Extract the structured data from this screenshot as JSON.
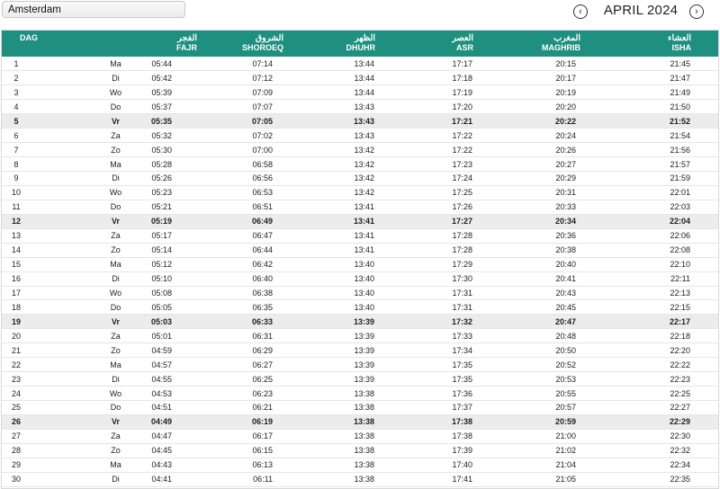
{
  "city_select": {
    "value": "Amsterdam"
  },
  "nav": {
    "prev_icon": "chevron-left-icon",
    "next_icon": "chevron-right-icon",
    "prev_glyph": "‹",
    "next_glyph": "›"
  },
  "month_title": "APRIL 2024",
  "header": {
    "dag": "DAG",
    "fajr_ar": "الفجر",
    "fajr": "FAJR",
    "shoroeq_ar": "الشروق",
    "shoroeq": "SHOROEQ",
    "dhuhr_ar": "الظهر",
    "dhuhr": "DHUHR",
    "asr_ar": "العصر",
    "asr": "ASR",
    "maghrib_ar": "المغرب",
    "maghrib": "MAGHRIB",
    "isha_ar": "العشاء",
    "isha": "ISHA"
  },
  "colors": {
    "header_bg": "#1f8f7f",
    "friday_bg": "#ececec"
  },
  "rows": [
    {
      "day": "1",
      "wd": "Ma",
      "fajr": "05:44",
      "shoroeq": "07:14",
      "dhuhr": "13:44",
      "asr": "17:17",
      "maghrib": "20:15",
      "isha": "21:45"
    },
    {
      "day": "2",
      "wd": "Di",
      "fajr": "05:42",
      "shoroeq": "07:12",
      "dhuhr": "13:44",
      "asr": "17:18",
      "maghrib": "20:17",
      "isha": "21:47"
    },
    {
      "day": "3",
      "wd": "Wo",
      "fajr": "05:39",
      "shoroeq": "07:09",
      "dhuhr": "13:44",
      "asr": "17:19",
      "maghrib": "20:19",
      "isha": "21:49"
    },
    {
      "day": "4",
      "wd": "Do",
      "fajr": "05:37",
      "shoroeq": "07:07",
      "dhuhr": "13:43",
      "asr": "17:20",
      "maghrib": "20:20",
      "isha": "21:50"
    },
    {
      "day": "5",
      "wd": "Vr",
      "fajr": "05:35",
      "shoroeq": "07:05",
      "dhuhr": "13:43",
      "asr": "17:21",
      "maghrib": "20:22",
      "isha": "21:52",
      "friday": true
    },
    {
      "day": "6",
      "wd": "Za",
      "fajr": "05:32",
      "shoroeq": "07:02",
      "dhuhr": "13:43",
      "asr": "17:22",
      "maghrib": "20:24",
      "isha": "21:54"
    },
    {
      "day": "7",
      "wd": "Zo",
      "fajr": "05:30",
      "shoroeq": "07:00",
      "dhuhr": "13:42",
      "asr": "17:22",
      "maghrib": "20:26",
      "isha": "21:56"
    },
    {
      "day": "8",
      "wd": "Ma",
      "fajr": "05:28",
      "shoroeq": "06:58",
      "dhuhr": "13:42",
      "asr": "17:23",
      "maghrib": "20:27",
      "isha": "21:57"
    },
    {
      "day": "9",
      "wd": "Di",
      "fajr": "05:26",
      "shoroeq": "06:56",
      "dhuhr": "13:42",
      "asr": "17:24",
      "maghrib": "20:29",
      "isha": "21:59"
    },
    {
      "day": "10",
      "wd": "Wo",
      "fajr": "05:23",
      "shoroeq": "06:53",
      "dhuhr": "13:42",
      "asr": "17:25",
      "maghrib": "20:31",
      "isha": "22:01"
    },
    {
      "day": "11",
      "wd": "Do",
      "fajr": "05:21",
      "shoroeq": "06:51",
      "dhuhr": "13:41",
      "asr": "17:26",
      "maghrib": "20:33",
      "isha": "22:03"
    },
    {
      "day": "12",
      "wd": "Vr",
      "fajr": "05:19",
      "shoroeq": "06:49",
      "dhuhr": "13:41",
      "asr": "17:27",
      "maghrib": "20:34",
      "isha": "22:04",
      "friday": true
    },
    {
      "day": "13",
      "wd": "Za",
      "fajr": "05:17",
      "shoroeq": "06:47",
      "dhuhr": "13:41",
      "asr": "17:28",
      "maghrib": "20:36",
      "isha": "22:06"
    },
    {
      "day": "14",
      "wd": "Zo",
      "fajr": "05:14",
      "shoroeq": "06:44",
      "dhuhr": "13:41",
      "asr": "17:28",
      "maghrib": "20:38",
      "isha": "22:08"
    },
    {
      "day": "15",
      "wd": "Ma",
      "fajr": "05:12",
      "shoroeq": "06:42",
      "dhuhr": "13:40",
      "asr": "17:29",
      "maghrib": "20:40",
      "isha": "22:10"
    },
    {
      "day": "16",
      "wd": "Di",
      "fajr": "05:10",
      "shoroeq": "06:40",
      "dhuhr": "13:40",
      "asr": "17:30",
      "maghrib": "20:41",
      "isha": "22:11"
    },
    {
      "day": "17",
      "wd": "Wo",
      "fajr": "05:08",
      "shoroeq": "06:38",
      "dhuhr": "13:40",
      "asr": "17:31",
      "maghrib": "20:43",
      "isha": "22:13"
    },
    {
      "day": "18",
      "wd": "Do",
      "fajr": "05:05",
      "shoroeq": "06:35",
      "dhuhr": "13:40",
      "asr": "17:31",
      "maghrib": "20:45",
      "isha": "22:15"
    },
    {
      "day": "19",
      "wd": "Vr",
      "fajr": "05:03",
      "shoroeq": "06:33",
      "dhuhr": "13:39",
      "asr": "17:32",
      "maghrib": "20:47",
      "isha": "22:17",
      "friday": true
    },
    {
      "day": "20",
      "wd": "Za",
      "fajr": "05:01",
      "shoroeq": "06:31",
      "dhuhr": "13:39",
      "asr": "17:33",
      "maghrib": "20:48",
      "isha": "22:18"
    },
    {
      "day": "21",
      "wd": "Zo",
      "fajr": "04:59",
      "shoroeq": "06:29",
      "dhuhr": "13:39",
      "asr": "17:34",
      "maghrib": "20:50",
      "isha": "22:20"
    },
    {
      "day": "22",
      "wd": "Ma",
      "fajr": "04:57",
      "shoroeq": "06:27",
      "dhuhr": "13:39",
      "asr": "17:35",
      "maghrib": "20:52",
      "isha": "22:22"
    },
    {
      "day": "23",
      "wd": "Di",
      "fajr": "04:55",
      "shoroeq": "06:25",
      "dhuhr": "13:39",
      "asr": "17:35",
      "maghrib": "20:53",
      "isha": "22:23"
    },
    {
      "day": "24",
      "wd": "Wo",
      "fajr": "04:53",
      "shoroeq": "06:23",
      "dhuhr": "13:38",
      "asr": "17:36",
      "maghrib": "20:55",
      "isha": "22:25"
    },
    {
      "day": "25",
      "wd": "Do",
      "fajr": "04:51",
      "shoroeq": "06:21",
      "dhuhr": "13:38",
      "asr": "17:37",
      "maghrib": "20:57",
      "isha": "22:27"
    },
    {
      "day": "26",
      "wd": "Vr",
      "fajr": "04:49",
      "shoroeq": "06:19",
      "dhuhr": "13:38",
      "asr": "17:38",
      "maghrib": "20:59",
      "isha": "22:29",
      "friday": true
    },
    {
      "day": "27",
      "wd": "Za",
      "fajr": "04:47",
      "shoroeq": "06:17",
      "dhuhr": "13:38",
      "asr": "17:38",
      "maghrib": "21:00",
      "isha": "22:30"
    },
    {
      "day": "28",
      "wd": "Zo",
      "fajr": "04:45",
      "shoroeq": "06:15",
      "dhuhr": "13:38",
      "asr": "17:39",
      "maghrib": "21:02",
      "isha": "22:32"
    },
    {
      "day": "29",
      "wd": "Ma",
      "fajr": "04:43",
      "shoroeq": "06:13",
      "dhuhr": "13:38",
      "asr": "17:40",
      "maghrib": "21:04",
      "isha": "22:34"
    },
    {
      "day": "30",
      "wd": "Di",
      "fajr": "04:41",
      "shoroeq": "06:11",
      "dhuhr": "13:38",
      "asr": "17:41",
      "maghrib": "21:05",
      "isha": "22:35"
    }
  ]
}
